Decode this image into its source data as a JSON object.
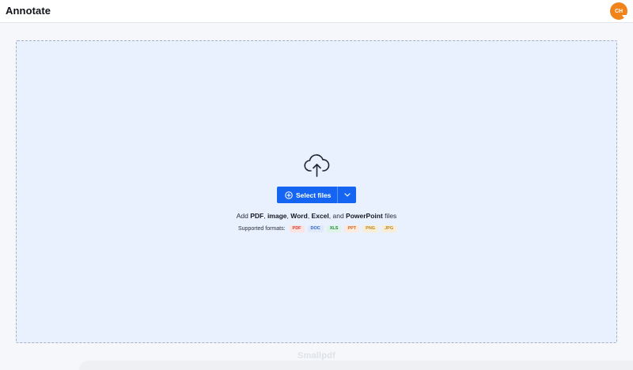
{
  "header": {
    "title": "Annotate",
    "avatar_initials": "CH"
  },
  "dropzone": {
    "icon": "cloud-upload-icon",
    "select_button_label": "Select files",
    "add_prefix": "Add ",
    "add_items": [
      "PDF",
      "image",
      "Word",
      "Excel",
      "PowerPoint"
    ],
    "add_sep1": ", ",
    "add_sep2": ", ",
    "add_sep3": ", ",
    "add_sep4": ", and ",
    "add_suffix": " files",
    "supported_label": "Supported formats:",
    "formats": [
      {
        "label": "PDF",
        "color": "#d93b30",
        "bg": "#fbe3e1"
      },
      {
        "label": "DOC",
        "color": "#2b62c9",
        "bg": "#dfe9fb"
      },
      {
        "label": "XLS",
        "color": "#1e8a43",
        "bg": "#dff3e6"
      },
      {
        "label": "PPT",
        "color": "#d9641e",
        "bg": "#fbeadd"
      },
      {
        "label": "PNG",
        "color": "#b9861a",
        "bg": "#f8eed8"
      },
      {
        "label": "JPG",
        "color": "#b9861a",
        "bg": "#f8eed8"
      }
    ]
  },
  "footer": {
    "watermark": "Smallpdf"
  },
  "colors": {
    "accent": "#1565f2",
    "avatar": "#f08319",
    "dropzone_bg": "#e9f1fe"
  }
}
